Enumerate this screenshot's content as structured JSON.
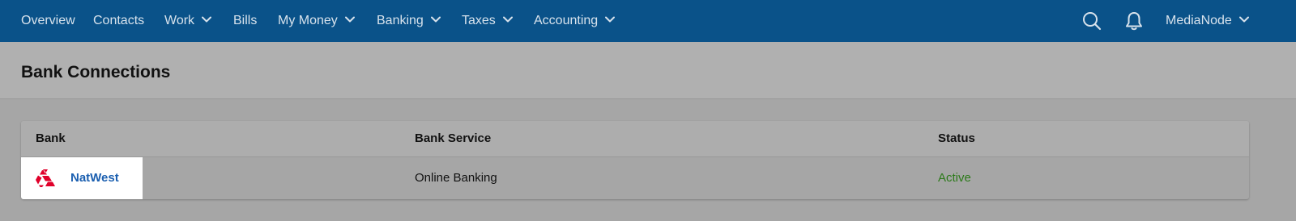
{
  "nav": {
    "items": [
      {
        "label": "Overview",
        "dropdown": false
      },
      {
        "label": "Contacts",
        "dropdown": false
      },
      {
        "label": "Work",
        "dropdown": true
      },
      {
        "label": "Bills",
        "dropdown": false
      },
      {
        "label": "My Money",
        "dropdown": true
      },
      {
        "label": "Banking",
        "dropdown": true
      },
      {
        "label": "Taxes",
        "dropdown": true
      },
      {
        "label": "Accounting",
        "dropdown": true
      }
    ],
    "icons": [
      "search-icon",
      "bell-icon"
    ],
    "account_label": "MediaNode"
  },
  "page": {
    "title": "Bank Connections"
  },
  "table": {
    "headers": [
      "Bank",
      "Bank Service",
      "Status"
    ],
    "rows": [
      {
        "bank": "NatWest",
        "bank_logo": "natwest-logo-icon",
        "service": "Online Banking",
        "status": "Active"
      }
    ]
  },
  "colors": {
    "nav_background": "#0a5289",
    "link": "#1b5fb0",
    "status_active": "#2c7a1a",
    "natwest_red": "#e0002a"
  }
}
